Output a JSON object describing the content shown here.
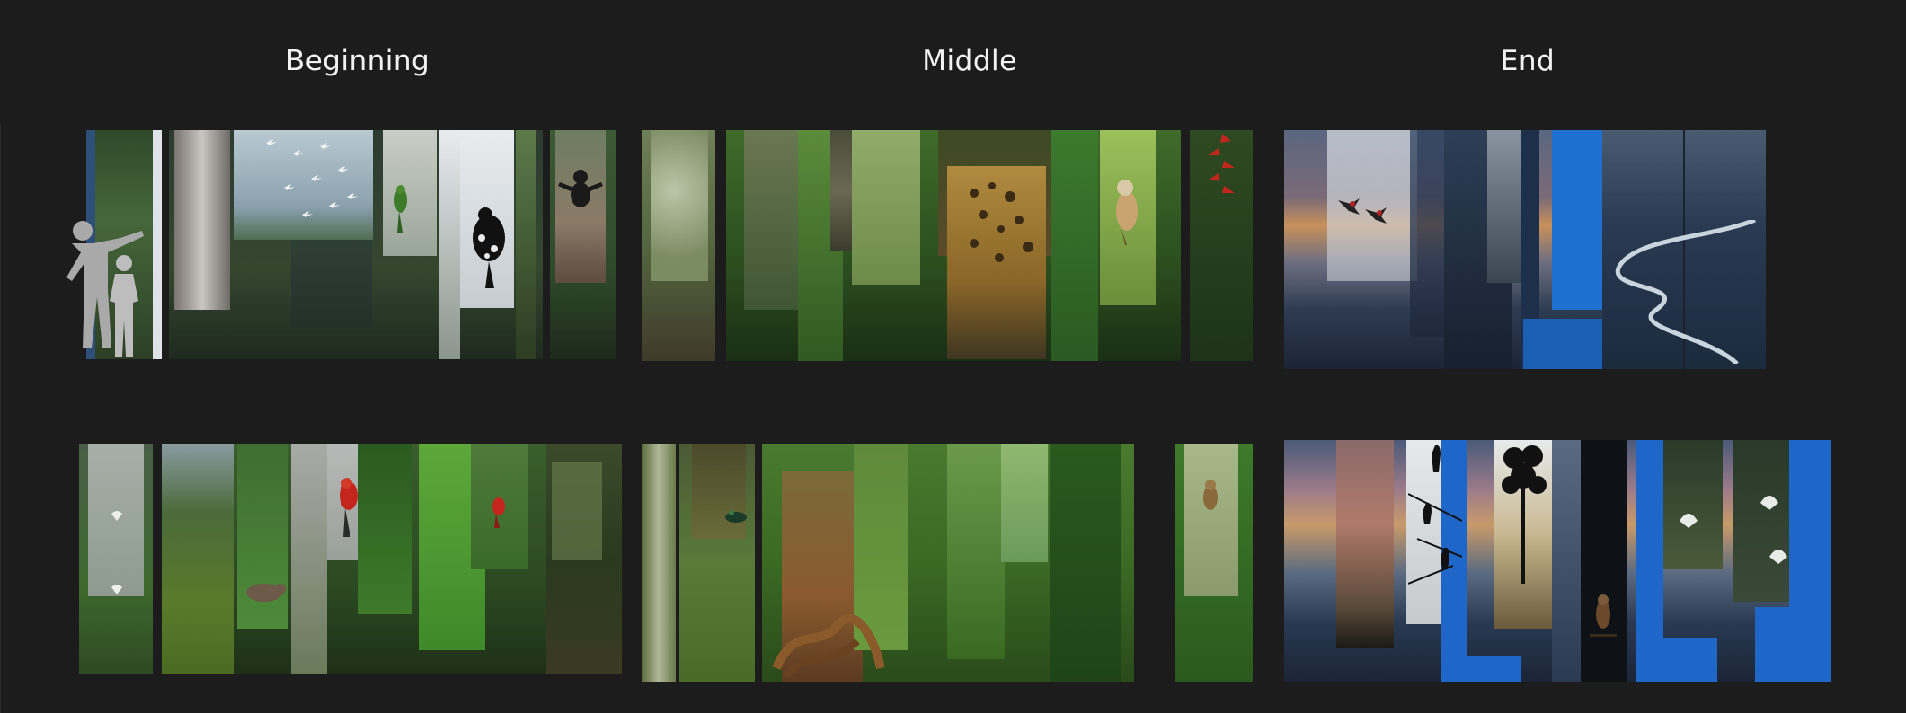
{
  "sections": {
    "beginning": {
      "label": "Beginning"
    },
    "middle": {
      "label": "Middle"
    },
    "end": {
      "label": "End"
    }
  },
  "colors": {
    "background": "#1c1c1c",
    "title": "#f2f2f2",
    "forest_dark": "#1f3b1e",
    "forest_mid": "#3f6b2c",
    "forest_light": "#7aa64a",
    "sky_blue": "#1e6fd0",
    "sunset": "#c98a5a",
    "dusk": "#2b3d55"
  },
  "collages": [
    {
      "section": "beginning",
      "row": "top",
      "theme": "forest",
      "human_silhouettes": true
    },
    {
      "section": "middle",
      "row": "top",
      "theme": "jungle"
    },
    {
      "section": "end",
      "row": "top",
      "theme": "sunset-river"
    },
    {
      "section": "beginning",
      "row": "bottom",
      "theme": "forest"
    },
    {
      "section": "middle",
      "row": "bottom",
      "theme": "jungle"
    },
    {
      "section": "end",
      "row": "bottom",
      "theme": "dusk-birds"
    }
  ]
}
